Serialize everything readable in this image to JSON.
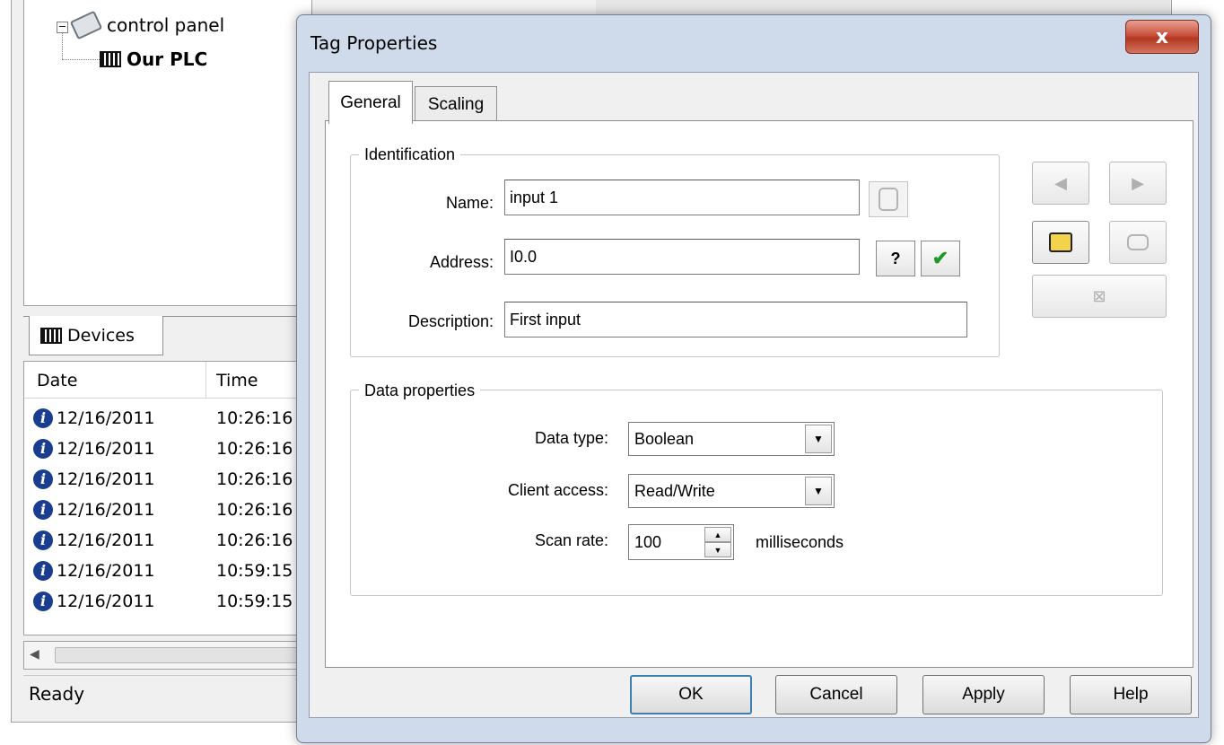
{
  "tree": {
    "root_label": "control panel",
    "expander": "−",
    "device_label": "Our PLC"
  },
  "devices_tab": {
    "label": "Devices"
  },
  "event_log": {
    "columns": [
      "Date",
      "Time"
    ],
    "rows": [
      {
        "date": "12/16/2011",
        "time": "10:26:16"
      },
      {
        "date": "12/16/2011",
        "time": "10:26:16"
      },
      {
        "date": "12/16/2011",
        "time": "10:26:16"
      },
      {
        "date": "12/16/2011",
        "time": "10:26:16"
      },
      {
        "date": "12/16/2011",
        "time": "10:26:16"
      },
      {
        "date": "12/16/2011",
        "time": "10:59:15"
      },
      {
        "date": "12/16/2011",
        "time": "10:59:15"
      }
    ]
  },
  "statusbar": {
    "text": "Ready"
  },
  "dialog": {
    "title": "Tag Properties",
    "close_glyph": "x",
    "tabs": [
      {
        "label": "General",
        "selected": true
      },
      {
        "label": "Scaling",
        "selected": false
      }
    ],
    "identification": {
      "title": "Identification",
      "name_label": "Name:",
      "name_value": "input 1",
      "address_label": "Address:",
      "address_value": "I0.0",
      "address_help": "?",
      "address_check": "✔",
      "description_label": "Description:",
      "description_value": "First input"
    },
    "data_properties": {
      "title": "Data properties",
      "data_type_label": "Data type:",
      "data_type_value": "Boolean",
      "client_access_label": "Client access:",
      "client_access_value": "Read/Write",
      "scan_rate_label": "Scan rate:",
      "scan_rate_value": "100",
      "scan_rate_unit": "milliseconds"
    },
    "buttons": {
      "ok": "OK",
      "cancel": "Cancel",
      "apply": "Apply",
      "help": "Help"
    },
    "colors": {
      "frame": "#cfdbeb",
      "close_button": "#c9503c",
      "check_green": "#1f9a2a"
    }
  }
}
